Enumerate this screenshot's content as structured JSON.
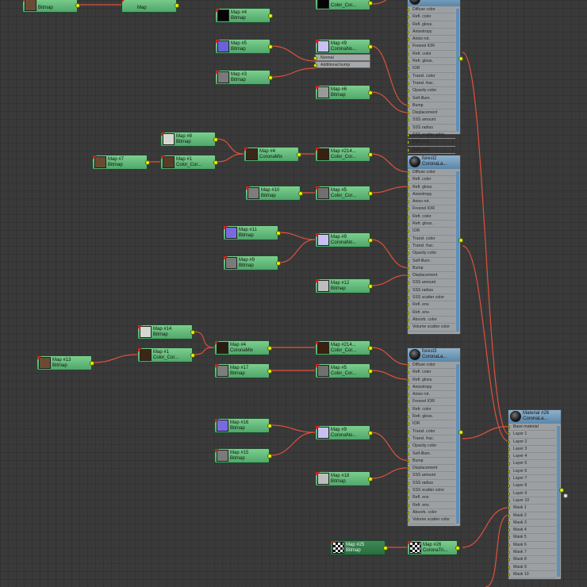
{
  "colors": {
    "canvas": "#3a3a3a",
    "map_node": "#5fb979",
    "wire": "#e0503c",
    "pin": "#e8f000",
    "material_header": "#6f9abf",
    "material_body": "#9da0a2"
  },
  "map_nodes": [
    {
      "id": "n_top_bitmap",
      "name": "",
      "type": "Bitmap",
      "thumb": "#6b4b36"
    },
    {
      "id": "n_top_map",
      "name": "",
      "type": "Map",
      "thumb": "none"
    },
    {
      "id": "n_map4_a",
      "name": "Map #4",
      "type": "Bitmap",
      "thumb": "#050505"
    },
    {
      "id": "n_top_colorcor",
      "name": "",
      "type": "Color_Cor...",
      "thumb": "#050505"
    },
    {
      "id": "n_map5_a",
      "name": "Map #5",
      "type": "Bitmap",
      "thumb": "#6a62d8"
    },
    {
      "id": "n_map9_a",
      "name": "Map #9",
      "type": "CoronaNo...",
      "thumb": "#c8c0f2",
      "subslots": [
        "Normal",
        "Additional bump"
      ]
    },
    {
      "id": "n_map3_a",
      "name": "Map #3",
      "type": "Bitmap",
      "thumb": "#7a7a7a"
    },
    {
      "id": "n_map6_a",
      "name": "Map #6",
      "type": "Bitmap",
      "thumb": "#9a9a9a"
    },
    {
      "id": "n_map8",
      "name": "Map #8",
      "type": "Bitmap",
      "thumb": "#d8d6d2"
    },
    {
      "id": "n_map7",
      "name": "Map #7",
      "type": "Bitmap",
      "thumb": "#6b4a33"
    },
    {
      "id": "n_map1_b",
      "name": "Map #1",
      "type": "Color_Cor...",
      "thumb": "#5a3d28"
    },
    {
      "id": "n_map4_b",
      "name": "Map #4",
      "type": "CoronaMix",
      "thumb": "#3a2718"
    },
    {
      "id": "n_map214_b",
      "name": "Map #214...",
      "type": "Color_Cor...",
      "thumb": "#3a2010"
    },
    {
      "id": "n_map10",
      "name": "Map #10",
      "type": "Bitmap",
      "thumb": "#7d7d7d"
    },
    {
      "id": "n_map5_b",
      "name": "Map #5",
      "type": "Color_Cor...",
      "thumb": "#707070"
    },
    {
      "id": "n_map11",
      "name": "Map #11",
      "type": "Bitmap",
      "thumb": "#7a6ae0"
    },
    {
      "id": "n_map9_b",
      "name": "Map #9",
      "type": "CoronaNo...",
      "thumb": "#c8c0f2"
    },
    {
      "id": "n_map9_c",
      "name": "Map #9",
      "type": "Bitmap",
      "thumb": "#7a7a7a"
    },
    {
      "id": "n_map12",
      "name": "Map #12",
      "type": "Bitmap",
      "thumb": "#bdbdbd"
    },
    {
      "id": "n_map14",
      "name": "Map #14",
      "type": "Bitmap",
      "thumb": "#d8d6d2"
    },
    {
      "id": "n_map13",
      "name": "Map #13",
      "type": "Bitmap",
      "thumb": "#6b4a33"
    },
    {
      "id": "n_map1_c",
      "name": "Map #1",
      "type": "Color_Cor...",
      "thumb": "#3a2718"
    },
    {
      "id": "n_map4_c",
      "name": "Map #4",
      "type": "CoronaMix",
      "thumb": "#2a1c10"
    },
    {
      "id": "n_map214_c",
      "name": "Map #214...",
      "type": "Color_Cor...",
      "thumb": "#3a2010"
    },
    {
      "id": "n_map17",
      "name": "Map #17",
      "type": "Bitmap",
      "thumb": "#7d7d7d"
    },
    {
      "id": "n_map5_c",
      "name": "Map #5",
      "type": "Color_Cor...",
      "thumb": "#707070"
    },
    {
      "id": "n_map16",
      "name": "Map #16",
      "type": "Bitmap",
      "thumb": "#7a6ae0"
    },
    {
      "id": "n_map9_d",
      "name": "Map #9",
      "type": "CoronaNo...",
      "thumb": "#c8c0f2"
    },
    {
      "id": "n_map15",
      "name": "Map #15",
      "type": "Bitmap",
      "thumb": "#7a7a7a"
    },
    {
      "id": "n_map18",
      "name": "Map #18",
      "type": "Bitmap",
      "thumb": "#bdbdbd"
    },
    {
      "id": "n_map25",
      "name": "Map #25",
      "type": "Bitmap",
      "thumb": "checker",
      "dark": true
    },
    {
      "id": "n_map26",
      "name": "Map #26",
      "type": "CoronaTri...",
      "thumb": "checker"
    }
  ],
  "material_slots": [
    "Diffuse color",
    "Refl. color",
    "Refl. gloss.",
    "Anisotropy",
    "Aniso rot.",
    "Fresnel IOR",
    "Refr. color",
    "Refr. gloss.",
    "IOR",
    "Transl. color",
    "Transl. frac.",
    "Opacity color",
    "Self-Illum.",
    "Bump",
    "Displacement",
    "SSS amount",
    "SSS radius",
    "SSS scatter color",
    "Refl. env.",
    "Refr. env.",
    "Absorb. color",
    "Volume scatter color"
  ],
  "materials": [
    {
      "id": "m_top",
      "name": "",
      "type": ""
    },
    {
      "id": "m_forest2",
      "name": "forest2",
      "type": "CoronaLa..."
    },
    {
      "id": "m_forest3",
      "name": "forest3",
      "type": "CoronaLa..."
    }
  ],
  "final_material": {
    "name": "Material #26",
    "type": "CoronaLa...",
    "slots": [
      "Base material",
      "Layer 1",
      "Layer 2",
      "Layer 3",
      "Layer 4",
      "Layer 5",
      "Layer 6",
      "Layer 7",
      "Layer 8",
      "Layer 9",
      "Layer 10",
      "Mask 1",
      "Mask 2",
      "Mask 3",
      "Mask 4",
      "Mask 5",
      "Mask 6",
      "Mask 7",
      "Mask 8",
      "Mask 9",
      "Mask 10"
    ]
  }
}
